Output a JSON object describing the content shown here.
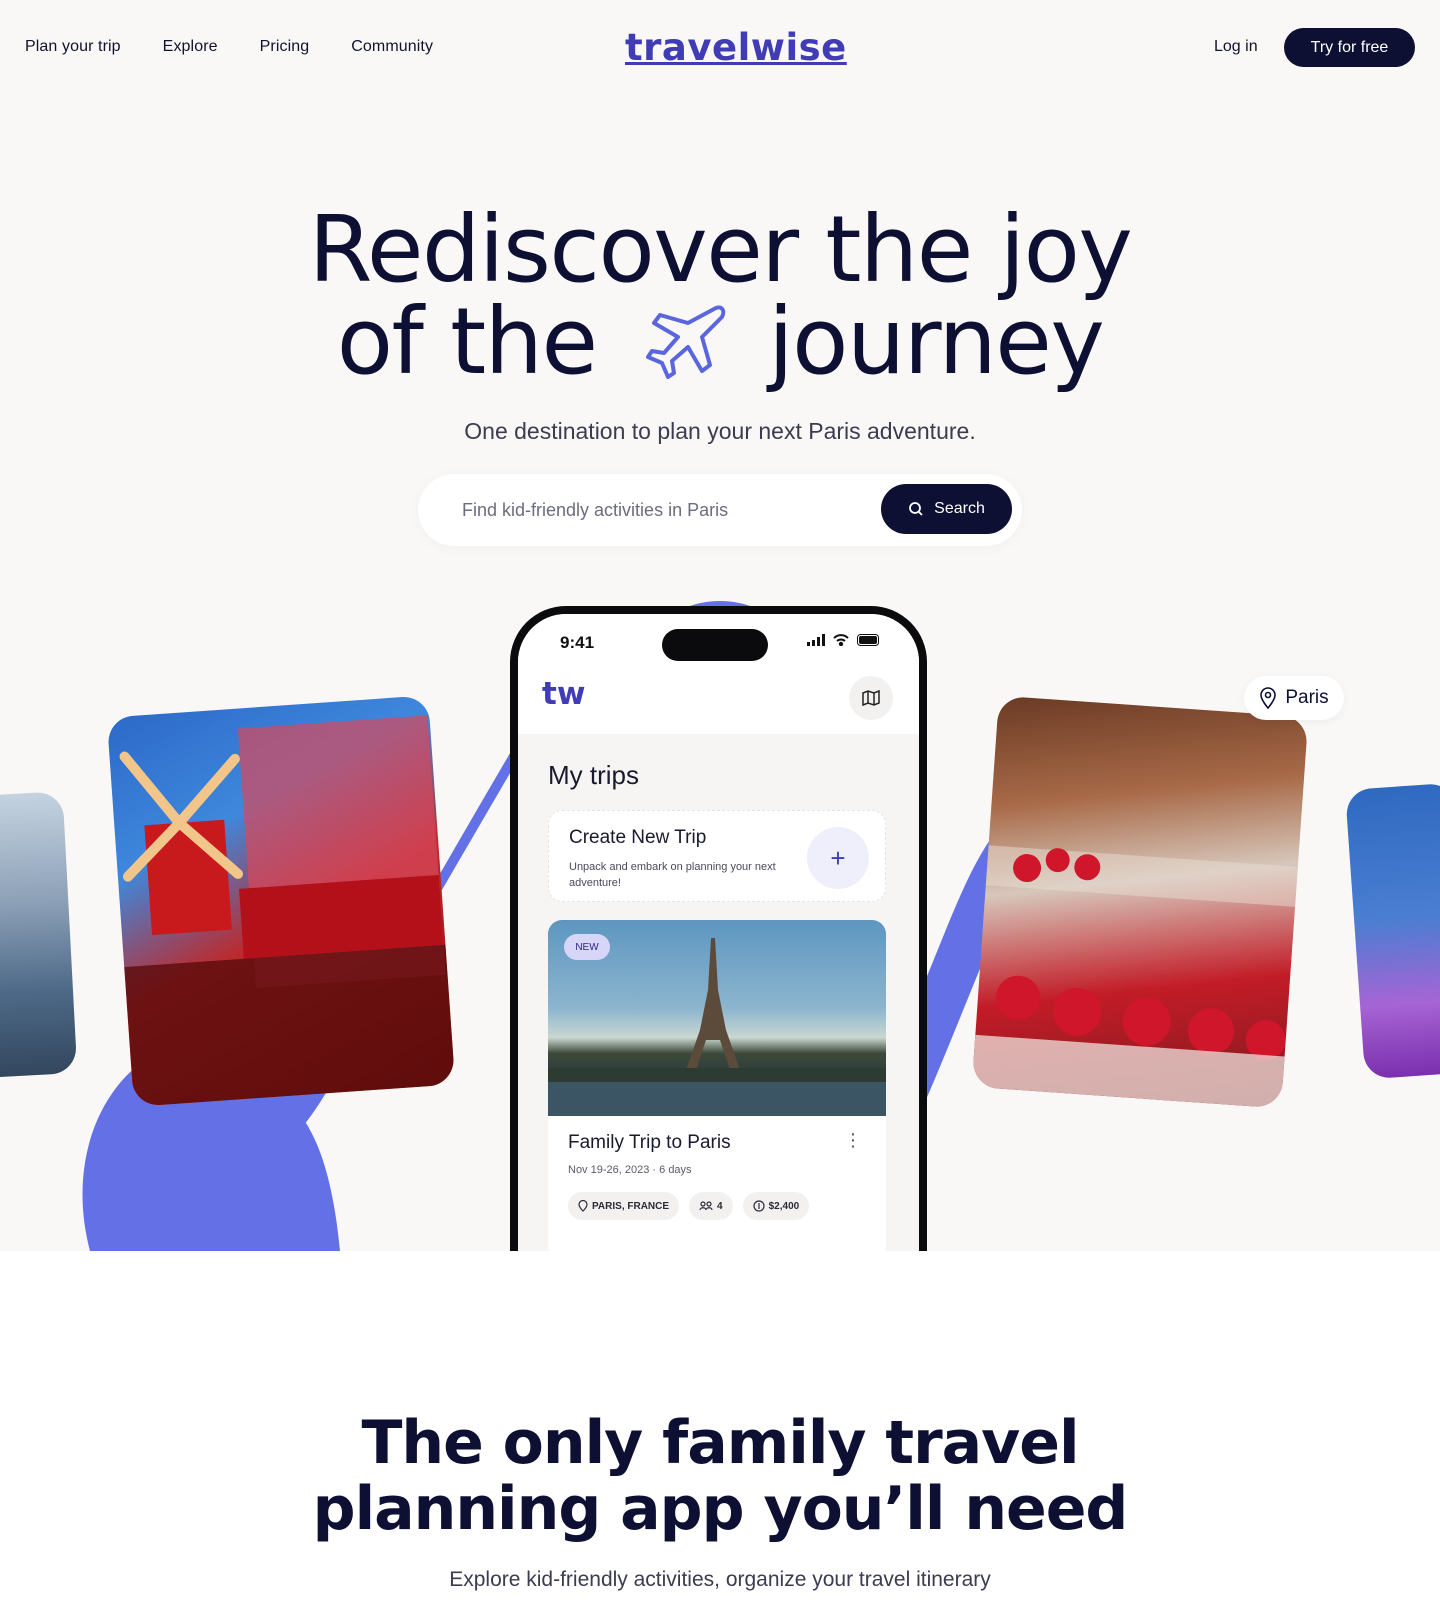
{
  "brand": {
    "logo": "travelwise",
    "app_logo": "tw",
    "accent": "#3f3cb5",
    "swoosh_color": "#6471e6",
    "dark": "#0e1033"
  },
  "nav": {
    "links": [
      "Plan your trip",
      "Explore",
      "Pricing",
      "Community"
    ],
    "login": "Log in",
    "cta": "Try for free"
  },
  "hero": {
    "line1": "Rediscover the joy",
    "line2_a": "of the",
    "line2_b": "journey",
    "plane_icon": "airplane-icon",
    "subtitle": "One destination to plan your next Paris adventure.",
    "search": {
      "placeholder": "Find kid-friendly activities in Paris",
      "value": "",
      "button": "Search"
    },
    "location_chip": "Paris"
  },
  "phone": {
    "time": "9:41",
    "screen_title": "My trips",
    "create": {
      "title": "Create New Trip",
      "subtitle": "Unpack and embark on planning your next adventure!",
      "plus": "+"
    },
    "trip": {
      "badge": "NEW",
      "title": "Family Trip to Paris",
      "dates": "Nov 19-26, 2023",
      "duration": "6 days",
      "tags": [
        "PARIS, FRANCE",
        "4",
        "$2,400"
      ]
    }
  },
  "section2": {
    "title_line1": "The only family travel",
    "title_line2": "planning app you’ll need",
    "subtitle": "Explore kid-friendly activities, organize your travel itinerary"
  }
}
